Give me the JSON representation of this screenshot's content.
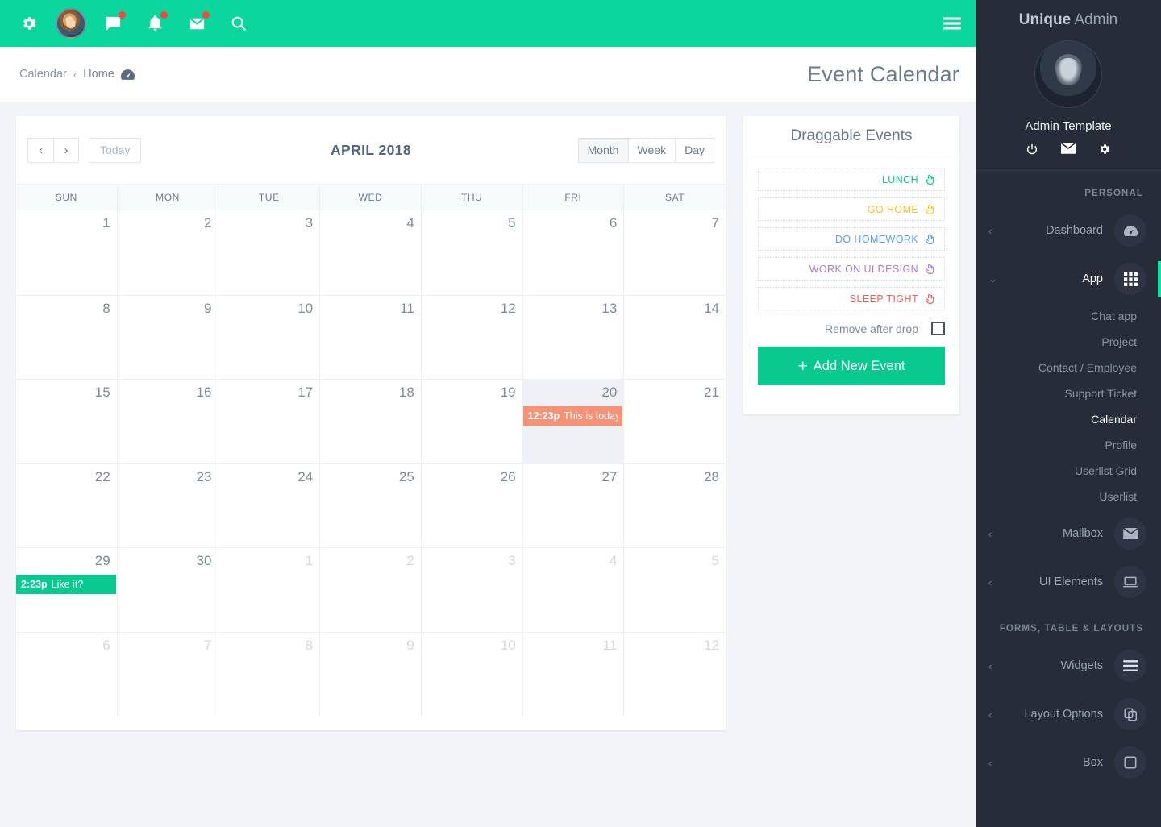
{
  "topbar": {
    "icons": [
      {
        "name": "gear-icon",
        "label": "Settings"
      },
      {
        "name": "chat-icon",
        "label": "Messages",
        "badge": true
      },
      {
        "name": "bell-icon",
        "label": "Notifications",
        "badge": true
      },
      {
        "name": "envelope-icon",
        "label": "Mail",
        "badge": true
      },
      {
        "name": "search-icon",
        "label": "Search"
      }
    ],
    "menu_label": "Menu",
    "bg_color": "#0bd69e"
  },
  "breadcrumb": {
    "current": "Calendar",
    "separator": "‹",
    "parent": "Home"
  },
  "header": {
    "page_title": "Event Calendar"
  },
  "calendar": {
    "prev_label": "‹",
    "next_label": "›",
    "today_label": "Today",
    "title": "APRIL 2018",
    "views": [
      {
        "label": "Month",
        "active": true
      },
      {
        "label": "Week",
        "active": false
      },
      {
        "label": "Day",
        "active": false
      }
    ],
    "day_headers": [
      "SUN",
      "MON",
      "TUE",
      "WED",
      "THU",
      "FRI",
      "SAT"
    ],
    "weeks": [
      [
        {
          "day": "1",
          "other": false
        },
        {
          "day": "2",
          "other": false
        },
        {
          "day": "3",
          "other": false
        },
        {
          "day": "4",
          "other": false
        },
        {
          "day": "5",
          "other": false
        },
        {
          "day": "6",
          "other": false
        },
        {
          "day": "7",
          "other": false
        }
      ],
      [
        {
          "day": "8",
          "other": false
        },
        {
          "day": "9",
          "other": false
        },
        {
          "day": "10",
          "other": false
        },
        {
          "day": "11",
          "other": false
        },
        {
          "day": "12",
          "other": false
        },
        {
          "day": "13",
          "other": false
        },
        {
          "day": "14",
          "other": false
        }
      ],
      [
        {
          "day": "15",
          "other": false
        },
        {
          "day": "16",
          "other": false
        },
        {
          "day": "17",
          "other": false
        },
        {
          "day": "18",
          "other": false
        },
        {
          "day": "19",
          "other": false
        },
        {
          "day": "20",
          "other": false,
          "today": true,
          "event": {
            "time": "12:23p",
            "title": "This is today",
            "color": "#f79277"
          }
        },
        {
          "day": "21",
          "other": false
        }
      ],
      [
        {
          "day": "22",
          "other": false
        },
        {
          "day": "23",
          "other": false
        },
        {
          "day": "24",
          "other": false
        },
        {
          "day": "25",
          "other": false
        },
        {
          "day": "26",
          "other": false
        },
        {
          "day": "27",
          "other": false
        },
        {
          "day": "28",
          "other": false
        }
      ],
      [
        {
          "day": "29",
          "other": false,
          "event": {
            "time": "2:23p",
            "title": "Like it?",
            "color": "#0ac98f"
          }
        },
        {
          "day": "30",
          "other": false
        },
        {
          "day": "1",
          "other": true
        },
        {
          "day": "2",
          "other": true
        },
        {
          "day": "3",
          "other": true
        },
        {
          "day": "4",
          "other": true
        },
        {
          "day": "5",
          "other": true
        }
      ],
      [
        {
          "day": "6",
          "other": true
        },
        {
          "day": "7",
          "other": true
        },
        {
          "day": "8",
          "other": true
        },
        {
          "day": "9",
          "other": true
        },
        {
          "day": "10",
          "other": true
        },
        {
          "day": "11",
          "other": true
        },
        {
          "day": "12",
          "other": true
        }
      ]
    ]
  },
  "draggable": {
    "title": "Draggable Events",
    "items": [
      {
        "label": "LUNCH",
        "color": "#0ac98f"
      },
      {
        "label": "GO HOME",
        "color": "#fbc02d"
      },
      {
        "label": "DO HOMEWORK",
        "color": "#5b9bf5"
      },
      {
        "label": "WORK ON UI DESIGN",
        "color": "#a97bdb"
      },
      {
        "label": "SLEEP TIGHT",
        "color": "#f4615a"
      }
    ],
    "remove_label": "Remove after drop",
    "remove_checked": false,
    "add_label": "Add New Event",
    "add_plus": "+"
  },
  "sidebar": {
    "brand_bold": "Unique",
    "brand_rest": " Admin",
    "profile_name": "Admin Template",
    "profile_icons": [
      {
        "name": "power-icon"
      },
      {
        "name": "envelope-icon"
      },
      {
        "name": "gear-icon"
      }
    ],
    "sections": [
      {
        "title": "PERSONAL",
        "items": [
          {
            "label": "Dashboard",
            "icon": "dashboard-icon",
            "caret": "‹",
            "active": false,
            "expanded": false
          },
          {
            "label": "App",
            "icon": "grid-icon",
            "caret": "⌄",
            "active": true,
            "expanded": true,
            "children": [
              {
                "label": "Chat app",
                "active": false
              },
              {
                "label": "Project",
                "active": false
              },
              {
                "label": "Contact / Employee",
                "active": false
              },
              {
                "label": "Support Ticket",
                "active": false
              },
              {
                "label": "Calendar",
                "active": true
              },
              {
                "label": "Profile",
                "active": false
              },
              {
                "label": "Userlist Grid",
                "active": false
              },
              {
                "label": "Userlist",
                "active": false
              }
            ]
          },
          {
            "label": "Mailbox",
            "icon": "envelope-icon",
            "caret": "‹",
            "active": false,
            "expanded": false
          },
          {
            "label": "UI Elements",
            "icon": "laptop-icon",
            "caret": "‹",
            "active": false,
            "expanded": false
          }
        ]
      },
      {
        "title": "FORMS, TABLE & LAYOUTS",
        "items": [
          {
            "label": "Widgets",
            "icon": "list-icon",
            "caret": "‹",
            "active": false,
            "expanded": false
          },
          {
            "label": "Layout Options",
            "icon": "copy-icon",
            "caret": "‹",
            "active": false,
            "expanded": false
          },
          {
            "label": "Box",
            "icon": "square-icon",
            "caret": "‹",
            "active": false,
            "expanded": false
          }
        ]
      }
    ]
  }
}
